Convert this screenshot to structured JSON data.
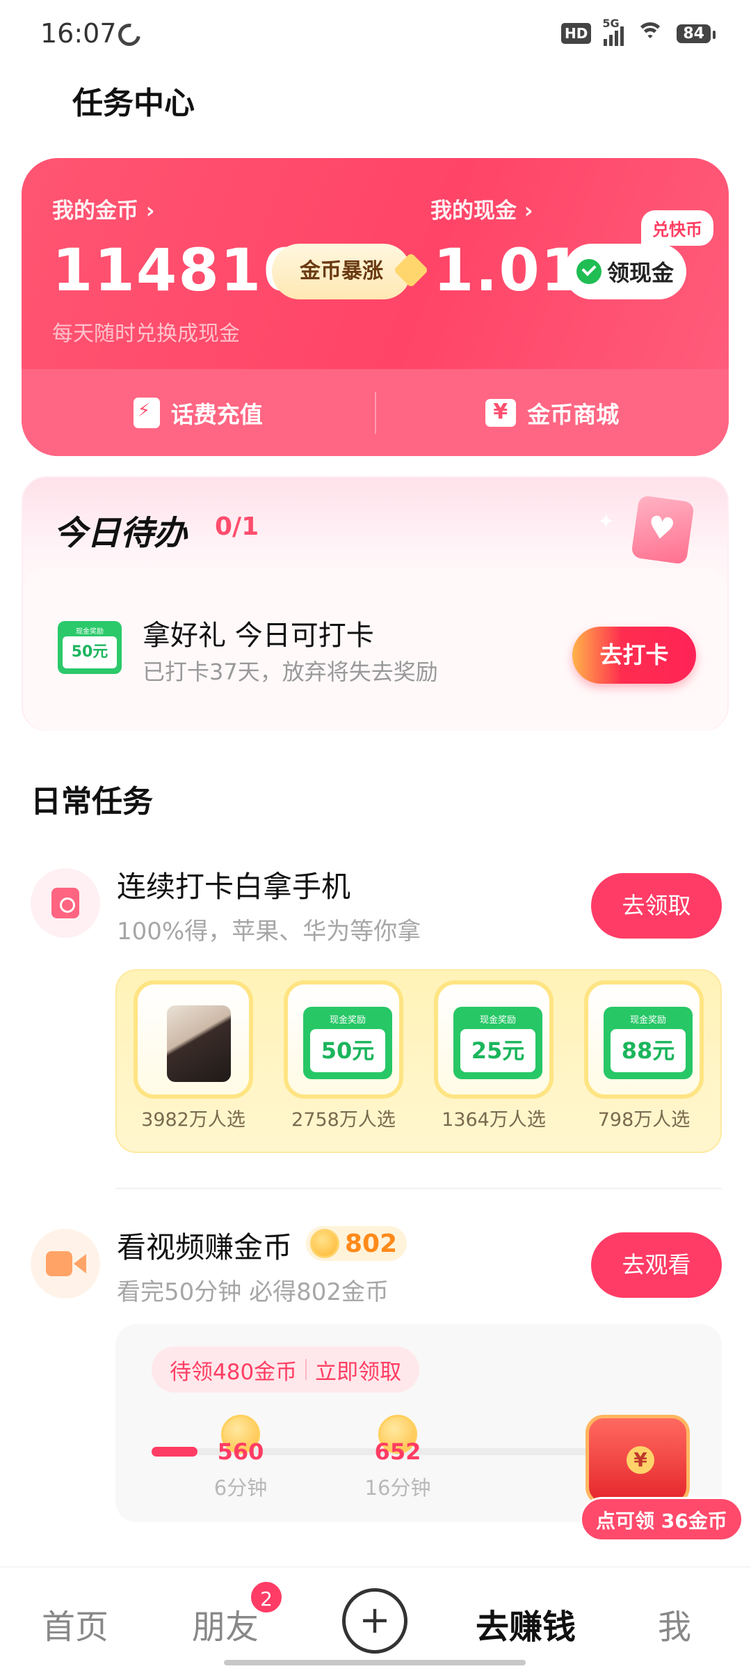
{
  "status_bar": {
    "time": "16:07",
    "network": "5G",
    "hd": "HD",
    "battery": "84"
  },
  "header": {
    "title": "任务中心"
  },
  "wallet": {
    "coins_label": "我的金币 ›",
    "coins_value": "114816",
    "coins_boost_button": "金币暴涨",
    "coins_tip": "每天随时兑换成现金",
    "cash_label": "我的现金 ›",
    "cash_value": "1.01",
    "cash_button": "领现金",
    "shortcuts": [
      {
        "label": "话费充值",
        "icon": "phone-bolt-icon"
      },
      {
        "label": "金币商城",
        "icon": "store-icon"
      }
    ],
    "store_badge": "兑快币"
  },
  "today_todo": {
    "title": "今日待办",
    "count": "0/1",
    "item": {
      "ticket_header": "现金奖励",
      "ticket_amount": "50元",
      "title": "拿好礼 今日可打卡",
      "subtitle": "已打卡37天，放弃将失去奖励",
      "button": "去打卡"
    }
  },
  "daily_tasks": {
    "title": "日常任务",
    "checkin_phone": {
      "title": "连续打卡白拿手机",
      "subtitle": "100%得，苹果、华为等你拿",
      "button": "去领取",
      "prizes": [
        {
          "kind": "phone",
          "caption": "3982万人选"
        },
        {
          "kind": "cash",
          "header": "现金奖励",
          "amount": "50元",
          "caption": "2758万人选"
        },
        {
          "kind": "cash",
          "header": "现金奖励",
          "amount": "25元",
          "caption": "1364万人选"
        },
        {
          "kind": "cash",
          "header": "现金奖励",
          "amount": "88元",
          "caption": "798万人选"
        }
      ]
    },
    "watch_video": {
      "title": "看视频赚金币",
      "coins": "802",
      "subtitle": "看完50分钟 必得802金币",
      "button": "去观看",
      "pending_label": "待领480金币",
      "claim_label": "立即领取",
      "progress_fraction": 0.1,
      "milestones": [
        {
          "coins": "560",
          "time": "6分钟"
        },
        {
          "coins": "652",
          "time": "16分钟"
        }
      ],
      "chest_label": "点可领 36金币"
    }
  },
  "bottom_nav": {
    "items": [
      {
        "label": "首页"
      },
      {
        "label": "朋友",
        "badge": "2"
      },
      {
        "label": "+"
      },
      {
        "label": "去赚钱",
        "active": true
      },
      {
        "label": "我"
      }
    ]
  },
  "colors": {
    "accent": "#ff3c66",
    "wallet": "#ff4d6d",
    "cash_green": "#27c766",
    "coin_orange": "#ff8a1a"
  }
}
